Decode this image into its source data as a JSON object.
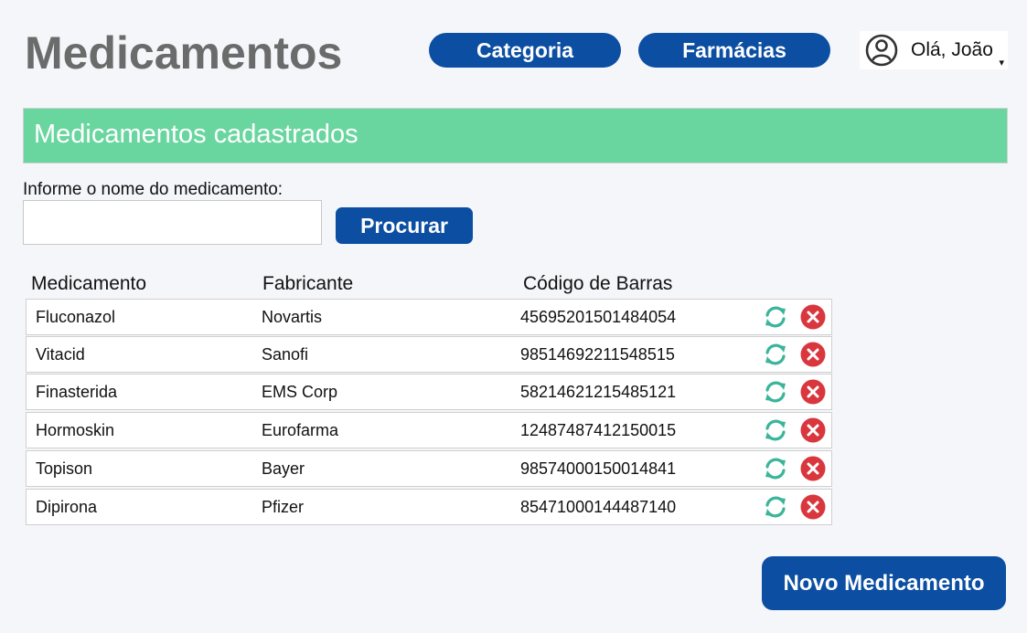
{
  "header": {
    "title": "Medicamentos",
    "nav": [
      {
        "label": "Categoria"
      },
      {
        "label": "Farmácias"
      }
    ],
    "user": {
      "greeting": "Olá, João",
      "avatar_icon": "user-circle-icon",
      "caret": "▾"
    }
  },
  "banner": {
    "title": "Medicamentos cadastrados"
  },
  "search": {
    "label": "Informe o nome do medicamento:",
    "value": "",
    "placeholder": "",
    "button_label": "Procurar"
  },
  "table": {
    "columns": [
      "Medicamento",
      "Fabricante",
      "Código de Barras"
    ],
    "rows": [
      {
        "medicamento": "Fluconazol",
        "fabricante": "Novartis",
        "codigo": "45695201501484054"
      },
      {
        "medicamento": "Vitacid",
        "fabricante": "Sanofi",
        "codigo": "98514692211548515"
      },
      {
        "medicamento": "Finasterida",
        "fabricante": "EMS Corp",
        "codigo": "58214621215485121"
      },
      {
        "medicamento": "Hormoskin",
        "fabricante": "Eurofarma",
        "codigo": "12487487412150015"
      },
      {
        "medicamento": "Topison",
        "fabricante": "Bayer",
        "codigo": "98574000150014841"
      },
      {
        "medicamento": "Dipirona",
        "fabricante": "Pfizer",
        "codigo": "85471000144487140"
      }
    ],
    "row_actions": {
      "update_icon": "refresh-icon",
      "delete_icon": "delete-icon"
    }
  },
  "footer": {
    "new_button_label": "Novo Medicamento"
  },
  "colors": {
    "primary": "#0b4ea2",
    "banner": "#69d6a0",
    "title_gray": "#6b6b6b",
    "refresh": "#3bb59a",
    "delete": "#d9363e",
    "background": "#f5f6fa"
  }
}
